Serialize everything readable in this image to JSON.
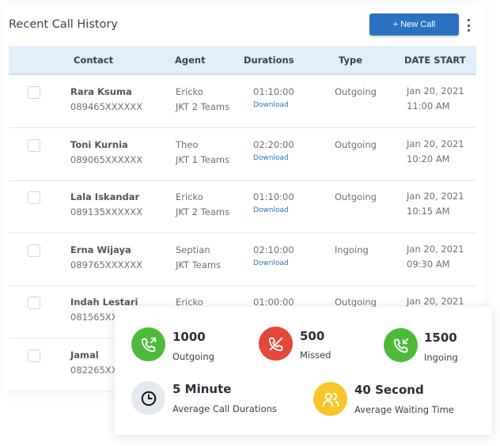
{
  "header": {
    "title": "Recent Call History",
    "new_call_label": "+ New Call"
  },
  "columns": [
    "Contact",
    "Agent",
    "Durations",
    "Type",
    "DATE START"
  ],
  "download_label": "Download",
  "rows": [
    {
      "name": "Rara Ksuma",
      "phone": "089465XXXXXX",
      "agent": "Ericko",
      "team": "JKT 2 Teams",
      "duration": "01:10:00",
      "type": "Outgoing",
      "date": "Jan 20, 2021",
      "time": "11:00 AM"
    },
    {
      "name": "Toni Kurnia",
      "phone": "089065XXXXXX",
      "agent": "Theo",
      "team": "JKT 1 Teams",
      "duration": "02:20:00",
      "type": "Outgoing",
      "date": "Jan 20, 2021",
      "time": "10:20 AM"
    },
    {
      "name": "Lala Iskandar",
      "phone": "089135XXXXXX",
      "agent": "Ericko",
      "team": "JKT 2 Teams",
      "duration": "01:10:00",
      "type": "Outgoing",
      "date": "Jan 20, 2021",
      "time": "10:15 AM"
    },
    {
      "name": "Erna Wijaya",
      "phone": "089765XXXXXX",
      "agent": "Septian",
      "team": "JKT Teams",
      "duration": "02:10:00",
      "type": "Ingoing",
      "date": "Jan 20, 2021",
      "time": "09:30 AM"
    },
    {
      "name": "Indah Lestari",
      "phone": "081565XX",
      "agent": "Ericko",
      "duration": "01:00:00",
      "type": "Outgoing",
      "date": "Jan 20, 2021"
    },
    {
      "name": "Jamal",
      "phone": "082265XX"
    }
  ],
  "stats": {
    "outgoing": {
      "value": "1000",
      "label": "Outgoing",
      "color": "#4cbb3a"
    },
    "missed": {
      "value": "500",
      "label": "Missed",
      "color": "#e2483a"
    },
    "ingoing": {
      "value": "1500",
      "label": "Ingoing",
      "color": "#4cbb3a"
    },
    "avg_duration": {
      "value": "5 Minute",
      "label": "Average Call Durations",
      "color": "#e4e9f0"
    },
    "avg_wait": {
      "value": "40 Second",
      "label": "Average Waiting Time",
      "color": "#f7c52a"
    }
  }
}
